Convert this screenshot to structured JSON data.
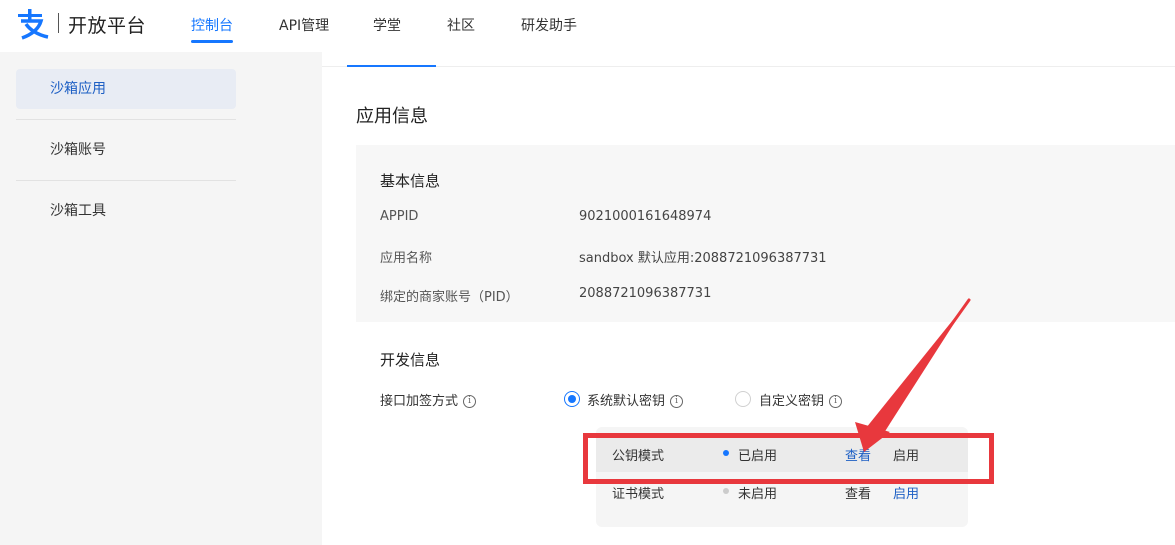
{
  "brand": {
    "title": "开放平台",
    "logo_icon": "alipay-logo-icon",
    "logo_color": "#1677ff"
  },
  "nav": {
    "items": [
      {
        "label": "控制台",
        "active": true
      },
      {
        "label": "API管理"
      },
      {
        "label": "学堂"
      },
      {
        "label": "社区"
      },
      {
        "label": "研发助手"
      }
    ]
  },
  "sidebar": {
    "items": [
      {
        "label": "沙箱应用",
        "active": true
      },
      {
        "label": "沙箱账号"
      },
      {
        "label": "沙箱工具"
      }
    ]
  },
  "main": {
    "section_title": "应用信息",
    "basic": {
      "title": "基本信息",
      "rows": [
        {
          "label": "APPID",
          "value": "9021000161648974"
        },
        {
          "label": "应用名称",
          "value": "sandbox 默认应用:2088721096387731"
        },
        {
          "label": "绑定的商家账号（PID）",
          "value": "2088721096387731"
        }
      ]
    },
    "dev": {
      "title": "开发信息",
      "sign_label": "接口加签方式",
      "options": [
        {
          "label": "系统默认密钥",
          "checked": true
        },
        {
          "label": "自定义密钥",
          "checked": false
        }
      ],
      "modes": [
        {
          "name": "公钥模式",
          "status": "已启用",
          "status_color": "#1677ff",
          "view": "查看",
          "enable": "启用"
        },
        {
          "name": "证书模式",
          "status": "未启用",
          "status_color": "#cccccc",
          "view": "查看",
          "enable": "启用"
        }
      ]
    }
  },
  "colors": {
    "accent": "#1677ff",
    "annotation": "#e8383d"
  }
}
